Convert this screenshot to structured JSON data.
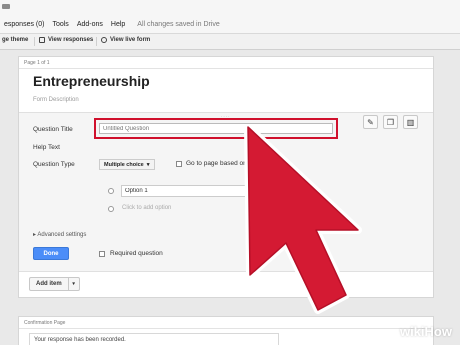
{
  "menu": {
    "items": [
      "esponses (0)",
      "Tools",
      "Add-ons",
      "Help"
    ],
    "saved_status": "All changes saved in Drive"
  },
  "toolbar": {
    "change_theme": "ge theme",
    "view_responses": "View responses",
    "view_live_form": "View live form"
  },
  "form": {
    "page_label": "Page 1 of 1",
    "title": "Entrepreneurship",
    "description_placeholder": "Form Description",
    "question": {
      "title_label": "Question Title",
      "title_placeholder": "Untitled Question",
      "help_label": "Help Text",
      "type_label": "Question Type",
      "type_value": "Multiple choice",
      "go_to_page_label": "Go to page based on answ",
      "option_1_value": "Option 1",
      "add_option_text": "Click to add option",
      "advanced_label": "Advanced settings",
      "done_label": "Done",
      "required_label": "Required question"
    },
    "add_item_label": "Add item"
  },
  "confirmation": {
    "page_label": "Confirmation Page",
    "message": "Your response has been recorded."
  },
  "watermark": {
    "wiki": "wiki",
    "how": "How"
  },
  "colors": {
    "highlight": "#d0102c",
    "cursor_fill": "#d41a33",
    "done_button": "#4b8df8"
  },
  "icons": [
    "folder-icon",
    "theme-icon",
    "responses-icon",
    "eye-icon",
    "pencil-icon",
    "copy-icon",
    "trash-icon",
    "chevron-down-icon",
    "triangle-right-icon",
    "cursor-arrow-icon"
  ]
}
